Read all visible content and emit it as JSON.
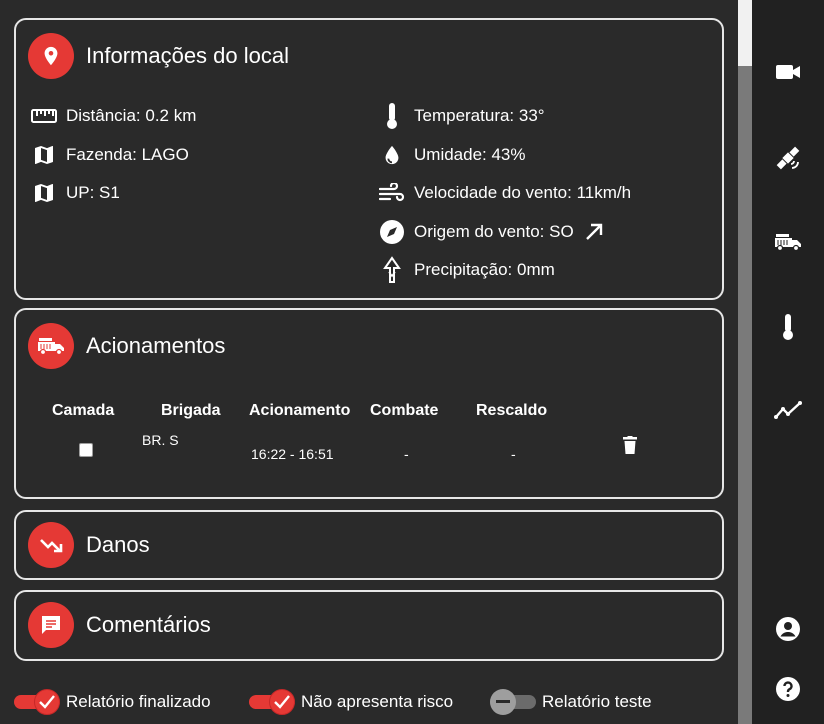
{
  "info_card": {
    "title": "Informações do local",
    "left": [
      {
        "icon": "ruler-icon",
        "text": "Distância: 0.2 km"
      },
      {
        "icon": "map-icon",
        "text": "Fazenda: LAGO"
      },
      {
        "icon": "map-icon",
        "text": "UP: S1"
      }
    ],
    "right": [
      {
        "icon": "thermometer-icon",
        "text": "Temperatura: 33°"
      },
      {
        "icon": "water-drop-icon",
        "text": "Umidade: 43%"
      },
      {
        "icon": "wind-icon",
        "text": "Velocidade do vento: 11km/h"
      },
      {
        "icon": "compass-icon",
        "text": "Origem do vento: SO"
      },
      {
        "icon": "precipitation-icon",
        "text": "Precipitação: 0mm"
      }
    ]
  },
  "acionamentos": {
    "title": "Acionamentos",
    "headers": [
      "Camada",
      "Brigada",
      "Acionamento",
      "Combate",
      "Rescaldo"
    ],
    "rows": [
      {
        "brigada": "BR. S",
        "acionamento": "16:22 - 16:51",
        "combate": "-",
        "rescaldo": "-"
      }
    ]
  },
  "danos": {
    "title": "Danos"
  },
  "comentarios": {
    "title": "Comentários"
  },
  "toggles": [
    {
      "label": "Relatório finalizado",
      "state": "on"
    },
    {
      "label": "Não apresenta risco",
      "state": "on"
    },
    {
      "label": "Relatório teste",
      "state": "off"
    }
  ],
  "colors": {
    "accent": "#e53935",
    "background": "#2a2a2a",
    "sidebar": "#212121",
    "border": "#e6e6e6"
  },
  "sidebar_icons": [
    "video-camera-icon",
    "satellite-icon",
    "fire-truck-icon",
    "thermometer-icon",
    "trend-line-icon",
    "account-icon",
    "help-icon"
  ]
}
